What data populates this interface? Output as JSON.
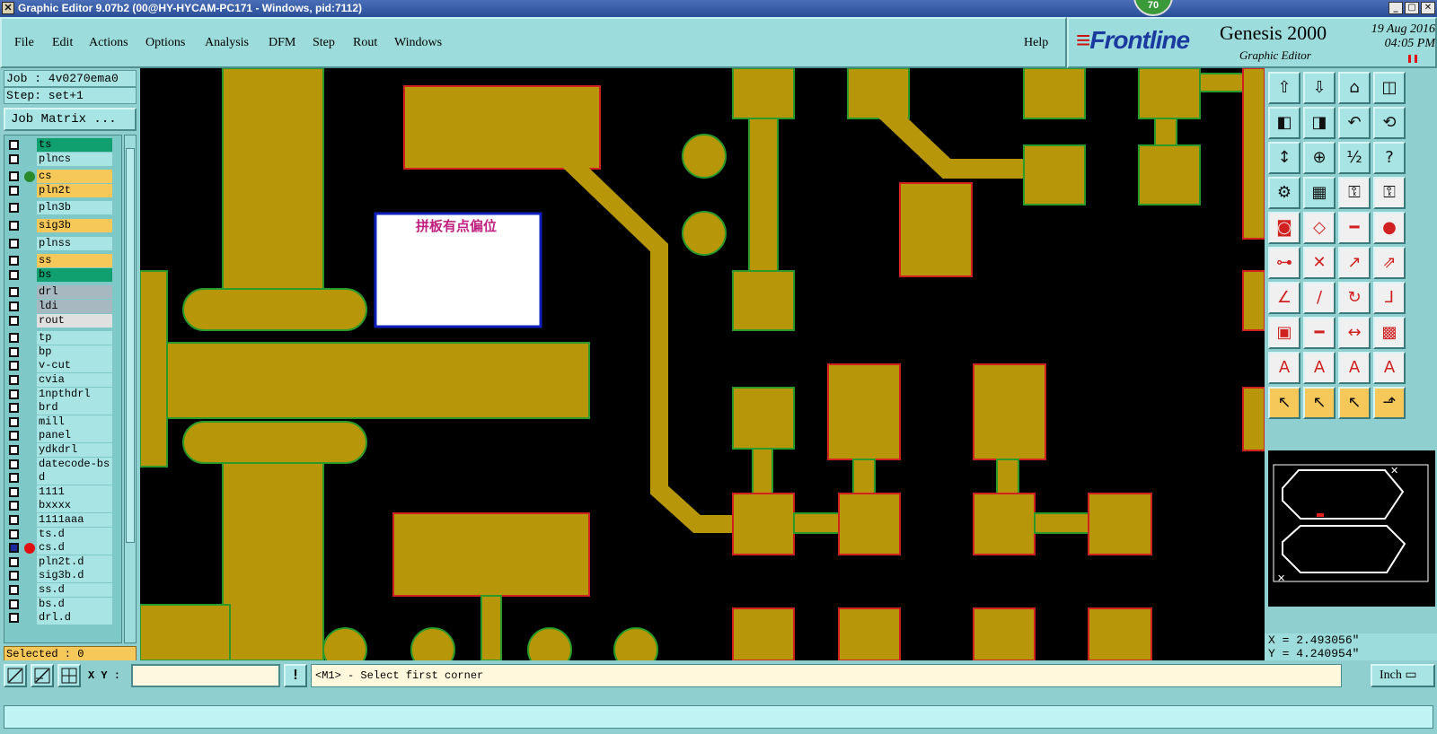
{
  "window": {
    "title": "Graphic Editor 9.07b2 (00@HY-HYCAM-PC171 - Windows, pid:7112)",
    "badge": "70"
  },
  "menu": {
    "items": [
      "File",
      "Edit",
      "Actions",
      "Options",
      "Analysis",
      "DFM",
      "Step",
      "Rout",
      "Windows"
    ],
    "help": "Help"
  },
  "brand": {
    "logo": "Frontline",
    "product": "Genesis 2000",
    "subtitle": "Graphic Editor",
    "date": "19 Aug 2016",
    "time": "04:05 PM"
  },
  "job": {
    "job_label": "Job : 4v0270ema0",
    "step_label": "Step: set+1",
    "matrix_button": "Job Matrix ..."
  },
  "layers": [
    {
      "name": "ts",
      "color": "#10a070",
      "dot": ""
    },
    {
      "name": "plncs",
      "color": "#a8e4e4",
      "dot": ""
    },
    {
      "name": "cs",
      "color": "#f6c85a",
      "dot": "#2a8a2a"
    },
    {
      "name": "pln2t",
      "color": "#f6c85a",
      "dot": ""
    },
    {
      "name": "pln3b",
      "color": "#a8e4e4",
      "dot": ""
    },
    {
      "name": "sig3b",
      "color": "#f6c85a",
      "dot": ""
    },
    {
      "name": "plnss",
      "color": "#a8e4e4",
      "dot": ""
    },
    {
      "name": "ss",
      "color": "#f6c85a",
      "dot": ""
    },
    {
      "name": "bs",
      "color": "#10a070",
      "dot": ""
    },
    {
      "name": "drl",
      "color": "#a8b8c0",
      "dot": ""
    },
    {
      "name": "ldi",
      "color": "#a8b8c0",
      "dot": ""
    },
    {
      "name": "rout",
      "color": "#e0e0e0",
      "dot": ""
    },
    {
      "name": "tp",
      "color": "#a8e4e4",
      "dot": ""
    },
    {
      "name": "bp",
      "color": "#a8e4e4",
      "dot": ""
    },
    {
      "name": "v-cut",
      "color": "#a8e4e4",
      "dot": ""
    },
    {
      "name": "cvia",
      "color": "#a8e4e4",
      "dot": ""
    },
    {
      "name": "1npthdrl",
      "color": "#a8e4e4",
      "dot": ""
    },
    {
      "name": "brd",
      "color": "#a8e4e4",
      "dot": ""
    },
    {
      "name": "mill",
      "color": "#a8e4e4",
      "dot": ""
    },
    {
      "name": "panel",
      "color": "#a8e4e4",
      "dot": ""
    },
    {
      "name": "ydkdrl",
      "color": "#a8e4e4",
      "dot": ""
    },
    {
      "name": "datecode-bs",
      "color": "#a8e4e4",
      "dot": ""
    },
    {
      "name": "d",
      "color": "#a8e4e4",
      "dot": ""
    },
    {
      "name": "1111",
      "color": "#a8e4e4",
      "dot": ""
    },
    {
      "name": "bxxxx",
      "color": "#a8e4e4",
      "dot": ""
    },
    {
      "name": "1111aaa",
      "color": "#a8e4e4",
      "dot": ""
    },
    {
      "name": "ts.d",
      "color": "#a8e4e4",
      "dot": ""
    },
    {
      "name": "cs.d",
      "color": "#a8e4e4",
      "dot": "#e01010"
    },
    {
      "name": "pln2t.d",
      "color": "#a8e4e4",
      "dot": ""
    },
    {
      "name": "sig3b.d",
      "color": "#a8e4e4",
      "dot": ""
    },
    {
      "name": "ss.d",
      "color": "#a8e4e4",
      "dot": ""
    },
    {
      "name": "bs.d",
      "color": "#a8e4e4",
      "dot": ""
    },
    {
      "name": "drl.d",
      "color": "#a8e4e4",
      "dot": ""
    }
  ],
  "selected_label": "Selected : 0",
  "canvas": {
    "note_text": "拼板有点偏位",
    "copper_color": "#b8960a"
  },
  "coords": {
    "x": "X = 2.493056\"",
    "y": "Y = 4.240954\""
  },
  "bottom": {
    "xy_label": "X Y :",
    "xy_value": "",
    "prompt": "<M1> - Select first corner",
    "units": "Inch"
  }
}
